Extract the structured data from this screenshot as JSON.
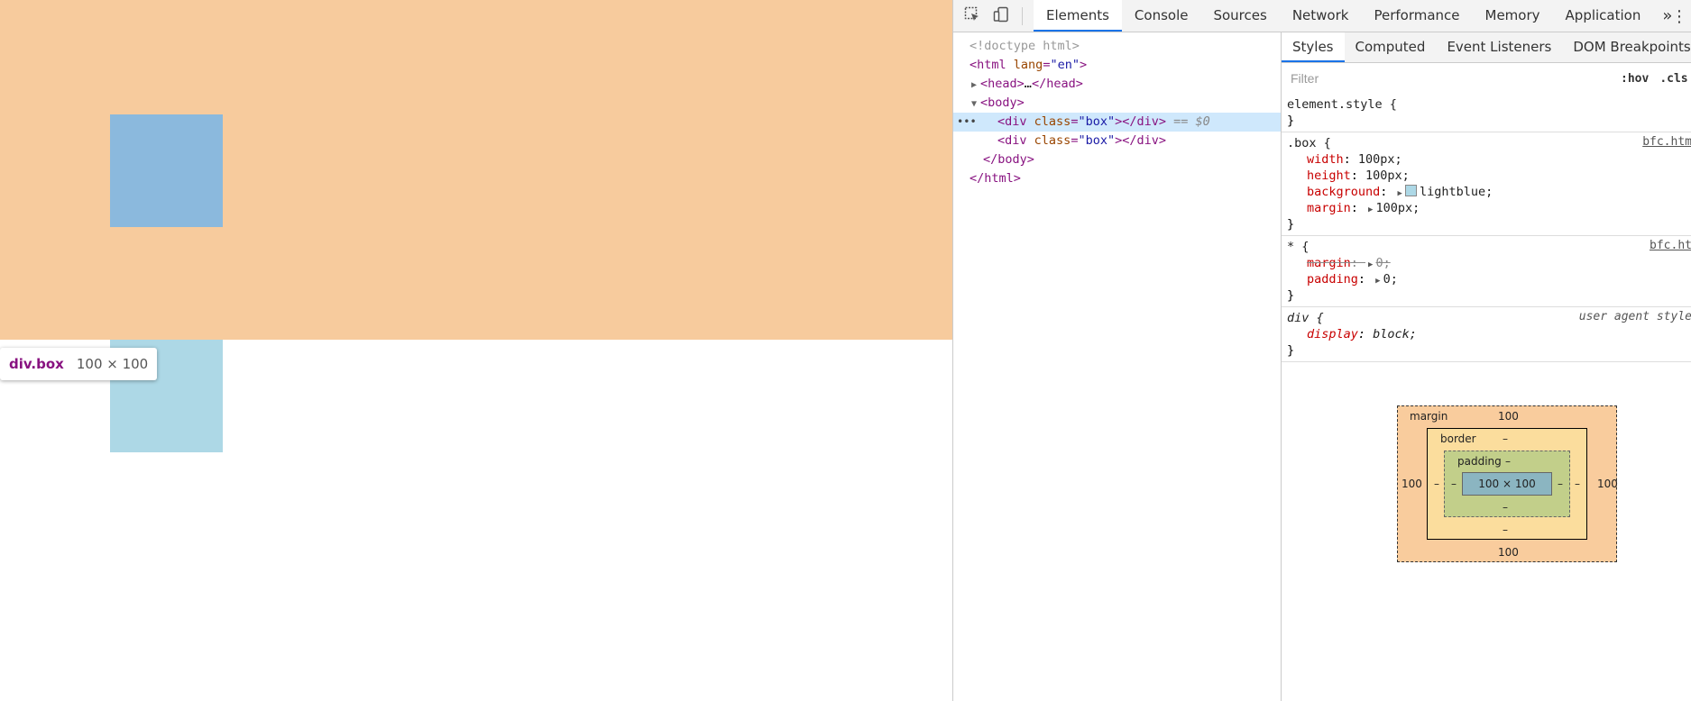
{
  "viewport": {
    "tooltip": {
      "tag": "div.box",
      "dimensions": "100 × 100"
    }
  },
  "devtools": {
    "main_tabs": [
      "Elements",
      "Console",
      "Sources",
      "Network",
      "Performance",
      "Memory",
      "Application"
    ],
    "active_main_tab": "Elements",
    "more_tabs_glyph": "»",
    "menu_glyph": "⋮",
    "dom": {
      "doctype": "<!doctype html>",
      "html_open_tag": "html",
      "html_attr": "lang",
      "html_attr_val": "\"en\"",
      "head_collapsed": "…",
      "head_tag": "head",
      "body_tag": "body",
      "div_tag": "div",
      "div_attr": "class",
      "div_attr_val": "\"box\"",
      "selected_marker": "== $0",
      "row_dots": "•••"
    },
    "sub_tabs": [
      "Styles",
      "Computed",
      "Event Listeners",
      "DOM Breakpoints"
    ],
    "active_sub_tab": "Styles",
    "filter": {
      "placeholder": "Filter",
      "value": "",
      "hov": ":hov",
      "cls": ".cls"
    },
    "rules": [
      {
        "selector": "element.style {",
        "source": "",
        "props": []
      },
      {
        "selector": ".box {",
        "source": "bfc.htm",
        "props": [
          {
            "name": "width",
            "value": "100px;"
          },
          {
            "name": "height",
            "value": "100px;"
          },
          {
            "name": "background",
            "value": "lightblue;",
            "swatch": "#add8e6"
          },
          {
            "name": "margin",
            "value": "100px;"
          }
        ]
      },
      {
        "selector": "* {",
        "source": "bfc.ht",
        "props": [
          {
            "name": "margin",
            "value": "0;",
            "struck": true
          },
          {
            "name": "padding",
            "value": "0;"
          }
        ]
      },
      {
        "selector": "div {",
        "source": "user agent style",
        "props": [
          {
            "name": "display",
            "value": "block;"
          }
        ]
      }
    ],
    "closing_brace": "}",
    "box_model": {
      "margin_label": "margin",
      "margin_top": "100",
      "margin_right": "100",
      "margin_bottom": "100",
      "margin_left": "100",
      "border_label": "border",
      "border_top": "–",
      "border_right": "–",
      "border_bottom": "–",
      "border_left": "–",
      "padding_label": "padding",
      "padding_top": "–",
      "padding_right": "–",
      "padding_bottom": "–",
      "padding_left": "–",
      "content": "100 × 100"
    }
  },
  "colors": {
    "margin_highlight": "#f7cb9d",
    "content_highlight": "#8bb9dd",
    "box_lightblue": "#add8e6",
    "active_tab_accent": "#1a73e8"
  }
}
